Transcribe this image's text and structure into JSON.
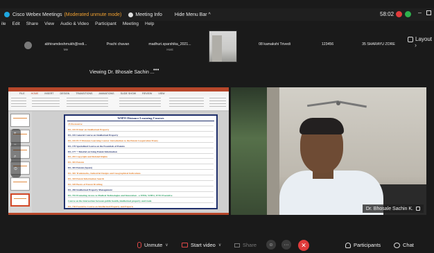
{
  "titlebar": {
    "app_title": "Cisco Webex Meetings",
    "mode": "(Moderated unmute mode)",
    "meeting_info": "Meeting Info",
    "hide_menu": "Hide Menu Bar",
    "hide_menu_caret": "^",
    "timer": "58:02",
    "minimize": "–"
  },
  "menu": [
    "ile",
    "Edit",
    "Share",
    "View",
    "Audio & Video",
    "Participant",
    "Meeting",
    "Help"
  ],
  "participants": [
    {
      "name": "abhiramdeshmukh@redi...",
      "role": "Me"
    },
    {
      "name": "Prachi chavan",
      "role": ""
    },
    {
      "name": "madhuri.sparshika_2021...",
      "role": "Host"
    },
    {
      "name": "08 kamakshi Trivedi",
      "role": ""
    },
    {
      "name": "123456",
      "role": ""
    },
    {
      "name": "35 SHARAYU ZORE",
      "role": ""
    }
  ],
  "strip_next": "›",
  "layout_label": "Layout",
  "viewing_label": "Viewing Dr. Bhosale Sachin ...",
  "viewing_dots": "•••",
  "ppt": {
    "tabs": [
      "FILE",
      "HOME",
      "INSERT",
      "DESIGN",
      "TRANSITIONS",
      "ANIMATIONS",
      "SLIDE SHOW",
      "REVIEW",
      "VIEW"
    ],
    "slide_title": "WIPO Distance Learning Courses",
    "courses": [
      {
        "text": "25 Postcourse",
        "color": "#e07820"
      },
      {
        "text": "DL-101 Primer on Intellectual Property",
        "color": "#e07820"
      },
      {
        "text": "DL-101 General Course on Intellectual Property",
        "color": "#1f2f6b"
      },
      {
        "text": "DL-101 PCT Distance Learning Course: Introduction to the Patent Cooperation Treaty",
        "color": "#e07820"
      },
      {
        "text": "DL-170 Specialized Course on the Essentials of Patents",
        "color": "#1f2f6b"
      },
      {
        "text": "DL-177 + Tutorial on Using Patent Information",
        "color": "#1f2f6b"
      },
      {
        "text": "DL-201 Copyright and Related Rights",
        "color": "#e07820"
      },
      {
        "text": "DL-301 Patents",
        "color": "#e07820"
      },
      {
        "text": "DL-301 Patents (Spare)",
        "color": "#1f2f6b"
      },
      {
        "text": "DL-302 Trademarks, Industrial Designs and Geographical Indications",
        "color": "#e07820"
      },
      {
        "text": "DL-318 Patent Information Search",
        "color": "#e07820"
      },
      {
        "text": "DL-320 Basics of Patent Drafting",
        "color": "#e07820"
      },
      {
        "text": "DL-450 Intellectual Property Management",
        "color": "#1f2f6b"
      },
      {
        "text": "DL-701 Promoting Access to Medical Technologies and Innovation - a WHO, WIPO, WTO Executive",
        "color": "#1f9a5a"
      },
      {
        "text": "Course on the intersection between public health, intellectual property and trade",
        "color": "#1f9a5a"
      },
      {
        "text": "DL-730 Executive Course on Intellectual Property and Exports",
        "color": "#e07820"
      }
    ],
    "vctl_icons": [
      "+",
      "−",
      "⌕",
      "⊙"
    ]
  },
  "video": {
    "name": "Dr. Bhosale Sachin K."
  },
  "controls": {
    "unmute": "Unmute",
    "start_video": "Start video",
    "share": "Share",
    "participants": "Participants",
    "chat": "Chat",
    "more": "···",
    "end": "✕",
    "reaction": "☺",
    "caret": "∨"
  },
  "colors": {
    "accent": "#1ea7e1",
    "mode": "#f0a030",
    "end_call": "#e03b3b",
    "muted": "#e04848",
    "ppt": "#b7472a"
  }
}
